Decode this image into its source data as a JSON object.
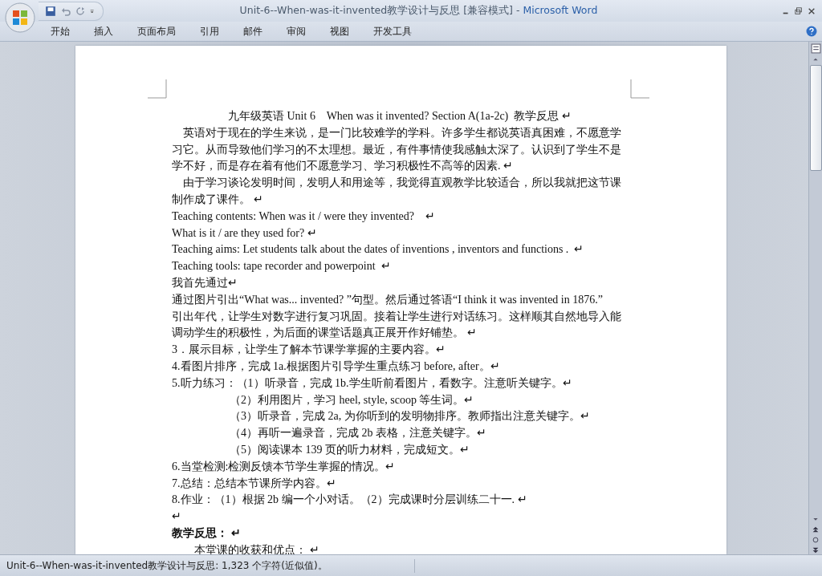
{
  "window": {
    "title": "Unit-6--When-was-it-invented教学设计与反思 [兼容模式]",
    "separator": "-",
    "app": "Microsoft Word"
  },
  "ribbon_tabs": [
    {
      "label": "开始",
      "selected": false
    },
    {
      "label": "插入",
      "selected": false
    },
    {
      "label": "页面布局",
      "selected": false
    },
    {
      "label": "引用",
      "selected": false
    },
    {
      "label": "邮件",
      "selected": false
    },
    {
      "label": "审阅",
      "selected": false
    },
    {
      "label": "视图",
      "selected": false
    },
    {
      "label": "开发工具",
      "selected": false
    }
  ],
  "document": {
    "lines": [
      {
        "kind": "title",
        "text": "九年级英语 Unit 6    When was it invented? Section A(1a-2c)  教学反思 ↵"
      },
      {
        "kind": "first",
        "text": "英语对于现在的学生来说，是一门比较难学的学科。许多学生都说英语真困难，不愿意学"
      },
      {
        "kind": "plain",
        "text": "习它。从而导致他们学习的不太理想。最近，有件事情使我感触太深了。认识到了学生不是"
      },
      {
        "kind": "plain",
        "text": "学不好，而是存在着有他们不愿意学习、学习积极性不高等的因素. ↵"
      },
      {
        "kind": "first",
        "text": "由于学习谈论发明时间，发明人和用途等，我觉得直观教学比较适合，所以我就把这节课"
      },
      {
        "kind": "plain",
        "text": "制作成了课件。 ↵"
      },
      {
        "kind": "plain",
        "text": "Teaching contents: When was it / were they invented?    ↵"
      },
      {
        "kind": "plain",
        "text": "What is it / are they used for? ↵"
      },
      {
        "kind": "plain",
        "text": "Teaching aims: Let students talk about the dates of inventions , inventors and functions .  ↵"
      },
      {
        "kind": "plain",
        "text": "Teaching tools: tape recorder and powerpoint  ↵"
      },
      {
        "kind": "plain",
        "text": "我首先通过↵"
      },
      {
        "kind": "plain",
        "text": "通过图片引出“What was... invented? ”句型。然后通过答语“I think it was invented in 1876.”"
      },
      {
        "kind": "plain",
        "text": "引出年代，让学生对数字进行复习巩固。接着让学生进行对话练习。这样顺其自然地导入能"
      },
      {
        "kind": "plain",
        "text": "调动学生的积极性，为后面的课堂话题真正展开作好铺垫。 ↵"
      },
      {
        "kind": "plain",
        "text": "3．展示目标，让学生了解本节课学掌握的主要内容。↵"
      },
      {
        "kind": "plain",
        "text": "4.看图片排序，完成 1a.根据图片引导学生重点练习 before, after。↵"
      },
      {
        "kind": "plain",
        "text": "5.听力练习：（1）听录音，完成 1b.学生听前看图片，看数字。注意听关键字。↵"
      },
      {
        "kind": "sub",
        "text": "（2）利用图片，学习 heel, style, scoop 等生词。↵"
      },
      {
        "kind": "sub",
        "text": "（3）听录音，完成 2a, 为你听到的发明物排序。教师指出注意关键字。↵"
      },
      {
        "kind": "sub",
        "text": "（4）再听一遍录音，完成 2b 表格，注意关键字。↵"
      },
      {
        "kind": "sub",
        "text": "（5）阅读课本 139 页的听力材料，完成短文。↵"
      },
      {
        "kind": "plain",
        "text": "6.当堂检测:检测反馈本节学生掌握的情况。↵"
      },
      {
        "kind": "plain",
        "text": "7.总结：总结本节课所学内容。↵"
      },
      {
        "kind": "plain",
        "text": "8.作业：（1）根据 2b 编一个小对话。（2）完成课时分层训练二十一. ↵"
      },
      {
        "kind": "plain",
        "text": "↵"
      },
      {
        "kind": "heading",
        "text": "教学反思： ↵"
      },
      {
        "kind": "indent",
        "text": "本堂课的收获和优点： ↵"
      }
    ]
  },
  "status_bar": {
    "text": "Unit-6--When-was-it-invented教学设计与反思: 1,323 个字符(近似值)。"
  }
}
